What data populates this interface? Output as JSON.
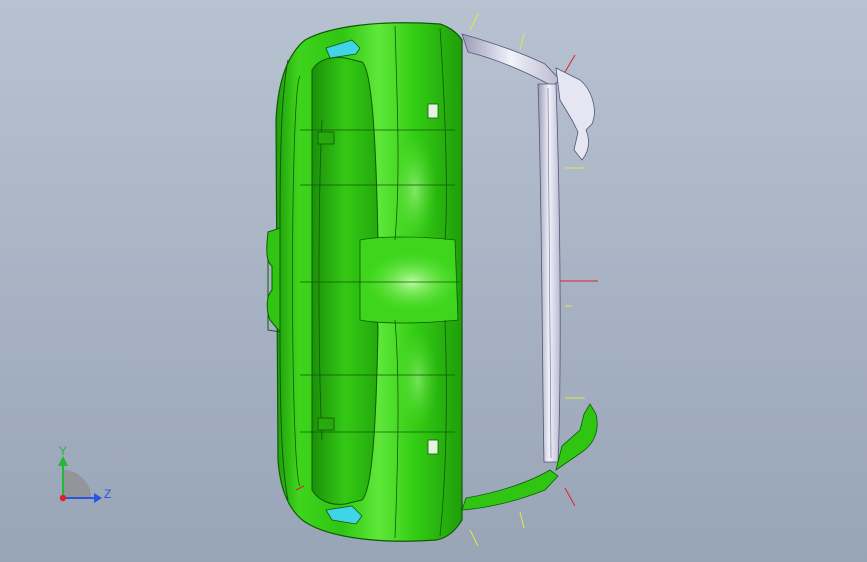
{
  "viewport": {
    "background_top": "#b7c2d1",
    "background_bottom": "#98a5b7"
  },
  "model": {
    "part_color": "#2fcf12",
    "part_color_light": "#7af05a",
    "part_color_dark": "#1a9c08",
    "trim_color": "#dcdcec",
    "clip_color": "#3fd5e6",
    "dim_line_yellow": "#e8e44a",
    "dim_line_red": "#e0202a"
  },
  "triad": {
    "y_label": "Y",
    "z_label": "Z",
    "y_color": "#22b83a",
    "z_color": "#2a55e0",
    "x_color": "#e0202a"
  }
}
